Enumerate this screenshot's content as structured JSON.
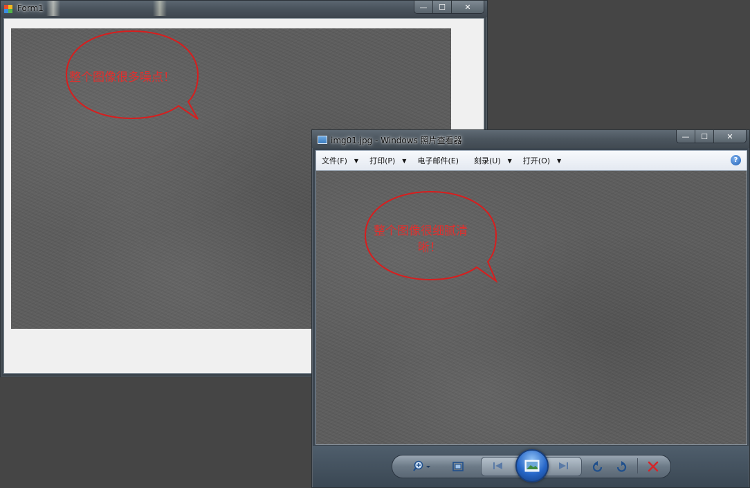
{
  "form1": {
    "title": "Form1",
    "callout_text": "整个图像很多噪点！",
    "controls": {
      "minimize": "—",
      "maximize": "☐",
      "close": "✕"
    }
  },
  "viewer": {
    "title": "img01.jpg - Windows 照片查看器",
    "callout_line1": "整个图像很细腻清",
    "callout_line2": "晰！",
    "controls": {
      "minimize": "—",
      "maximize": "☐",
      "close": "✕"
    },
    "menu": [
      {
        "label": "文件(F)"
      },
      {
        "label": "打印(P)"
      },
      {
        "label": "电子邮件(E)"
      },
      {
        "label": "刻录(U)"
      },
      {
        "label": "打开(O)"
      }
    ],
    "help_icon": "?",
    "toolbar_icons": [
      "zoom-icon",
      "fit-window-icon",
      "previous-icon",
      "slideshow-icon",
      "next-icon",
      "rotate-left-icon",
      "rotate-right-icon",
      "delete-icon"
    ]
  },
  "colors": {
    "callout": "#d81e1e",
    "desktop": "#454545"
  }
}
